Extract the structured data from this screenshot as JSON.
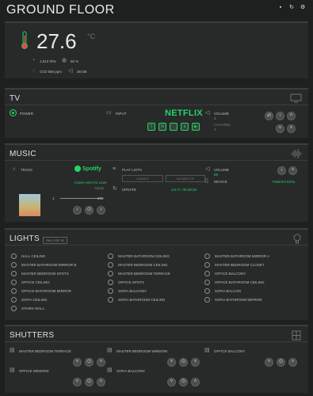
{
  "header": {
    "title": "GROUND FLOOR",
    "icons": [
      "chat-icon",
      "refresh-icon",
      "settings-icon"
    ]
  },
  "climate": {
    "temperature": "27.6",
    "unit": "°C",
    "pressure": "1,012 hPa",
    "humidity": "56 %",
    "co2": "CO2 556 ppm",
    "noise": "38 dB"
  },
  "tv": {
    "title": "TV",
    "power_label": "POWER",
    "input_label": "INPUT",
    "brand": "NETFLIX",
    "volume_label": "VOLUME",
    "volume_value": "3",
    "channel_label": "CHANNEL",
    "channel_value": "3",
    "apps": [
      "T",
      "N",
      "",
      "a",
      "▶"
    ]
  },
  "music": {
    "title": "MUSIC",
    "track_label": "TRACK",
    "service": "Spotify",
    "song": "Came Here for Love",
    "artist": "Sigala",
    "playlists_label": "PLAY LISTS",
    "playlist_btn1": "CANDLE",
    "playlist_btn2": "WOMEN OF",
    "updated_label": "UPDATE",
    "updated_time": "Jul 17, 09:49:28",
    "volume_label": "VOLUME",
    "volume_value": "69",
    "device_label": "DEVICE",
    "device_value": "Patrick's Echo",
    "progress_start": "1",
    "progress_end": "203"
  },
  "lights": {
    "title": "LIGHTS",
    "badge": "ON: 0 OF 19",
    "col1": [
      "HALL CEILING",
      "MASTER BATHROOM MIRROR B",
      "MASTER BEDROOM SPOTS",
      "OFFICE CEILING",
      "OFFICE BATHROOM MIRROR",
      "SOFIA CEILING",
      "STAIRS WALL"
    ],
    "col2": [
      "MASTER BATHROOM CEILING",
      "MASTER BEDROOM CEILING",
      "MASTER BEDROOM TERRACE",
      "OFFICE SPOTS",
      "SOFIA BALCONY",
      "SOFIA BATHROOM CEILING"
    ],
    "col3": [
      "MASTER BATHROOM MIRROR A",
      "MASTER BEDROOM CLOSET",
      "OFFICE BALCONY",
      "OFFICE BATHROOM CEILING",
      "SOFIA BALCON",
      "SOFIA BATHROOM MIRROR"
    ]
  },
  "shutters": {
    "title": "SHUTTERS",
    "row1": [
      "MASTER BEDROOM TERRACE",
      "MASTER BEDROOM WINDOW",
      "OFFICE BALCONY"
    ],
    "row2": [
      "OFFICE WINDOW",
      "SOFIA BALCONY"
    ]
  },
  "colors": {
    "accent": "#25d366",
    "background": "#1e2020",
    "card": "#272a29"
  }
}
